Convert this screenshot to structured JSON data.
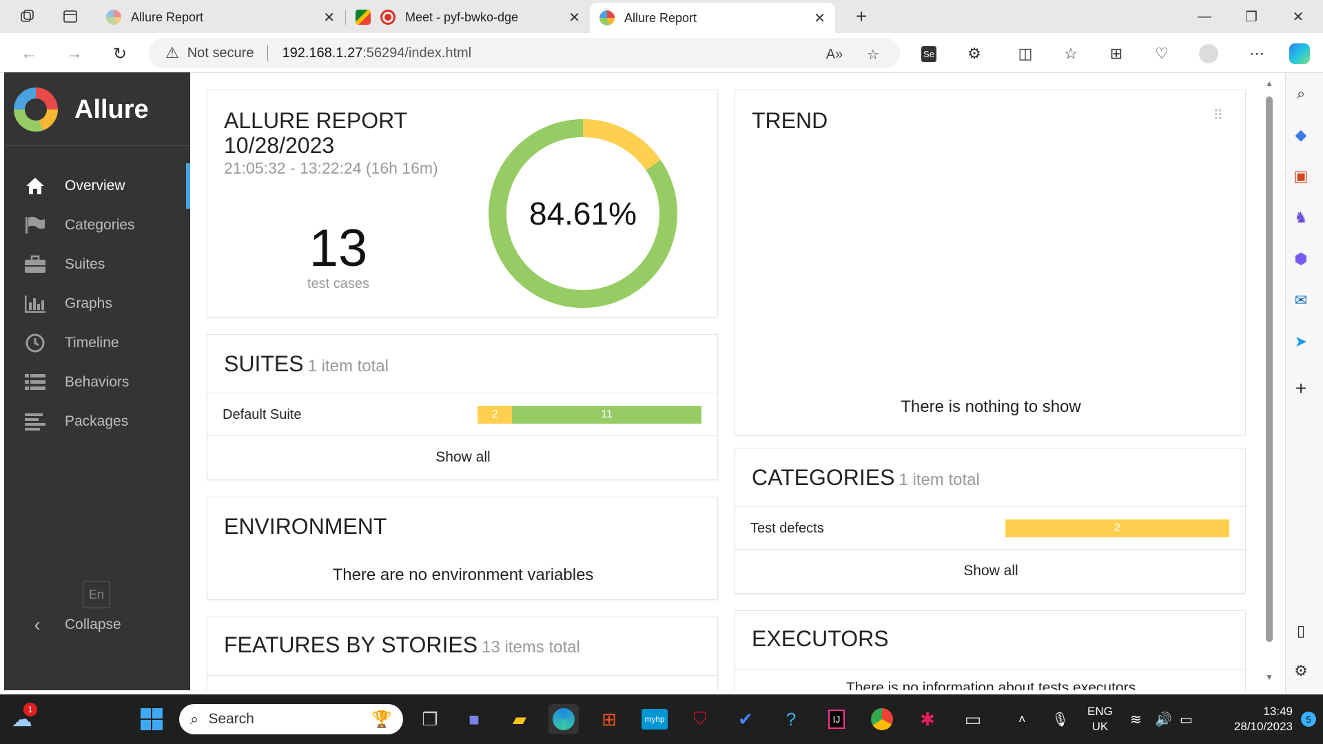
{
  "browser": {
    "tabs": [
      {
        "title": "Allure Report",
        "close": "✕"
      },
      {
        "title": "Meet - pyf-bwko-dge",
        "close": "✕"
      },
      {
        "title": "Allure Report",
        "close": "✕"
      }
    ],
    "new_tab": "+",
    "security_label": "Not secure",
    "url_host": "192.168.1.27",
    "url_rest": ":56294/index.html",
    "window_controls": {
      "minimize": "—",
      "restore": "❐",
      "close": "✕"
    }
  },
  "sidebar": {
    "brand": "Allure",
    "items": [
      {
        "label": "Overview",
        "icon": "home-icon"
      },
      {
        "label": "Categories",
        "icon": "flag-icon"
      },
      {
        "label": "Suites",
        "icon": "briefcase-icon"
      },
      {
        "label": "Graphs",
        "icon": "bar-chart-icon"
      },
      {
        "label": "Timeline",
        "icon": "clock-icon"
      },
      {
        "label": "Behaviors",
        "icon": "list-icon"
      },
      {
        "label": "Packages",
        "icon": "align-left-icon"
      }
    ],
    "language": "En",
    "collapse_label": "Collapse"
  },
  "summary": {
    "title": "ALLURE REPORT",
    "date": "10/28/2023",
    "time_range": "21:05:32 - 13:22:24 (16h 16m)",
    "test_count": "13",
    "test_count_label": "test cases",
    "success_rate": "84.61%",
    "passed_fraction": 0.8461,
    "broken_fraction": 0.1539
  },
  "trend": {
    "title": "TREND",
    "empty": "There is nothing to show"
  },
  "suites": {
    "title": "SUITES",
    "count_label": "1 item total",
    "rows": [
      {
        "name": "Default Suite",
        "broken": "2",
        "passed": "11",
        "broken_n": 2,
        "passed_n": 11
      }
    ],
    "show_all": "Show all"
  },
  "categories": {
    "title": "CATEGORIES",
    "count_label": "1 item total",
    "rows": [
      {
        "name": "Test defects",
        "value": "2"
      }
    ],
    "show_all": "Show all"
  },
  "environment": {
    "title": "ENVIRONMENT",
    "empty": "There are no environment variables"
  },
  "executors": {
    "title": "EXECUTORS",
    "empty": "There is no information about tests executors"
  },
  "features": {
    "title": "FEATURES BY STORIES",
    "count_label": "13 items total"
  },
  "colors": {
    "passed": "#97cc64",
    "broken": "#ffd050",
    "sidebar_bg": "#343434",
    "active_indicator": "#4aa3df"
  },
  "taskbar": {
    "search_placeholder": "Search",
    "language_line1": "ENG",
    "language_line2": "UK",
    "time": "13:49",
    "date": "28/10/2023",
    "notifications": "5",
    "weather_badge": "1"
  }
}
